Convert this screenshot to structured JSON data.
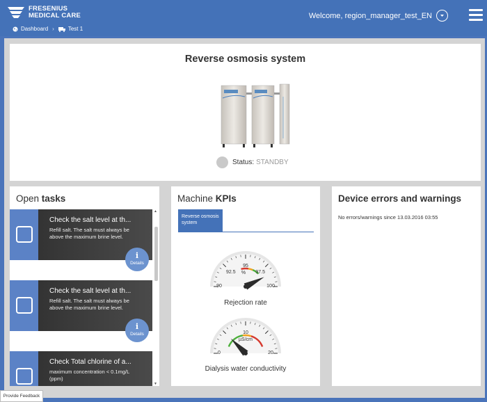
{
  "header": {
    "logo_line1": "FRESENIUS",
    "logo_line2": "MEDICAL CARE",
    "welcome": "Welcome, region_manager_test_EN",
    "breadcrumb": [
      "Dashboard",
      "Test 1"
    ]
  },
  "system": {
    "title": "Reverse osmosis system",
    "status_label": "Status:",
    "status_value": "STANDBY"
  },
  "tasks": {
    "title_light": "Open ",
    "title_bold": "tasks",
    "details_label": "Details",
    "items": [
      {
        "title": "Check the salt level at th...",
        "desc": "Refill salt. The salt must always be above the maximum brine level."
      },
      {
        "title": "Check the salt level at th...",
        "desc": "Refill salt. The salt must always be above the maximum brine level."
      },
      {
        "title": "Check Total chlorine of a...",
        "desc": "maximum concentration < 0.1mg/L (ppm)"
      }
    ]
  },
  "kpis": {
    "title_light": "Machine ",
    "title_bold": "KPIs",
    "tab": "Reverse osmosis system",
    "gauges": [
      {
        "label": "Rejection rate",
        "unit": "%",
        "ticks": [
          "90",
          "92.5",
          "95",
          "97.5",
          "100"
        ],
        "min": 90,
        "max": 100,
        "value": 98.5
      },
      {
        "label": "Dialysis water conductivity",
        "unit": "µS/cm",
        "ticks": [
          "0",
          "10",
          "20"
        ],
        "min": 0,
        "max": 20,
        "value": 5
      }
    ]
  },
  "errors": {
    "title": "Device errors and warnings",
    "text": "No errors/warnings since 13.03.2016 03:55"
  },
  "feedback": "Provide Feedback",
  "colors": {
    "brand": "#4472b8",
    "task_square": "#5b82c6",
    "details": "#6c93cf"
  }
}
